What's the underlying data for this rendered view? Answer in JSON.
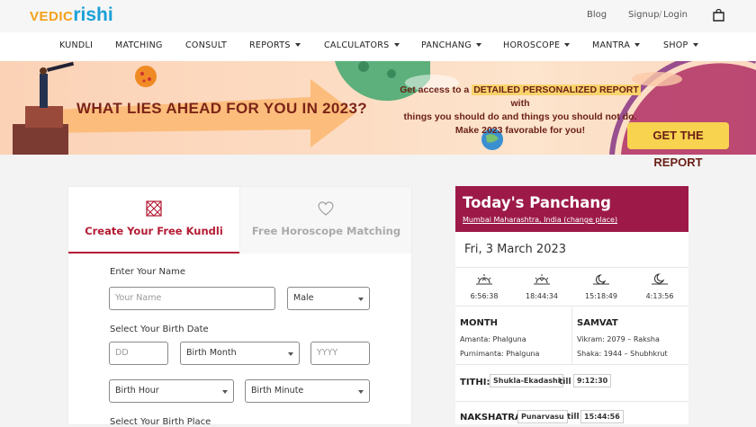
{
  "brand": {
    "part1": "VEDIC",
    "part2": "rishi"
  },
  "toplinks": {
    "blog": "Blog",
    "signup": "Signup",
    "sep": "/",
    "login": "Login"
  },
  "nav": [
    {
      "label": "KUNDLI",
      "caret": false
    },
    {
      "label": "MATCHING",
      "caret": false
    },
    {
      "label": "CONSULT",
      "caret": false
    },
    {
      "label": "REPORTS",
      "caret": true
    },
    {
      "label": "CALCULATORS",
      "caret": true
    },
    {
      "label": "PANCHANG",
      "caret": true
    },
    {
      "label": "HOROSCOPE",
      "caret": true
    },
    {
      "label": "MANTRA",
      "caret": true
    },
    {
      "label": "SHOP",
      "caret": true
    }
  ],
  "banner": {
    "title": "WHAT LIES AHEAD FOR YOU IN 2023?",
    "line1a": "Get access to a ",
    "line1b": "DETAILED PERSONALIZED REPORT",
    "line1c": " with",
    "line2": "things you should do and things you should not do.",
    "line3": "Make 2023 favorable for you!",
    "cta": "GET THE REPORT"
  },
  "form": {
    "tab_kundli": "Create Your Free Kundli",
    "tab_matching": "Free Horoscope Matching",
    "name_label": "Enter Your Name",
    "name_placeholder": "Your Name",
    "gender": "Male",
    "dob_label": "Select Your Birth Date",
    "dd_placeholder": "DD",
    "month": "Birth Month",
    "yyyy_placeholder": "YYYY",
    "hour": "Birth Hour",
    "minute": "Birth Minute",
    "place_label": "Select Your Birth Place"
  },
  "panchang": {
    "title": "Today's Panchang",
    "location": "Mumbai Maharashtra, India (change place)",
    "date": "Fri, 3 March 2023",
    "sunrise": "6:56:38",
    "sunset": "18:44:34",
    "moonrise": "15:18:49",
    "moonset": "4:13:56",
    "month_head": "MONTH",
    "amanta": "Amanta: Phalguna",
    "purnimanta": "Purnimanta: Phalguna",
    "samvat_head": "SAMVAT",
    "vikram": "Vikram: 2079 – Raksha",
    "shaka": "Shaka: 1944 – Shubhkrut",
    "tithi_label": "TITHI:",
    "tithi_value": "Shukla-Ekadashi",
    "till": "till",
    "tithi_time": "9:12:30",
    "nakshatra_label": "NAKSHATRA:",
    "nakshatra_value": "Punarvasu",
    "nakshatra_time": "15:44:56"
  }
}
